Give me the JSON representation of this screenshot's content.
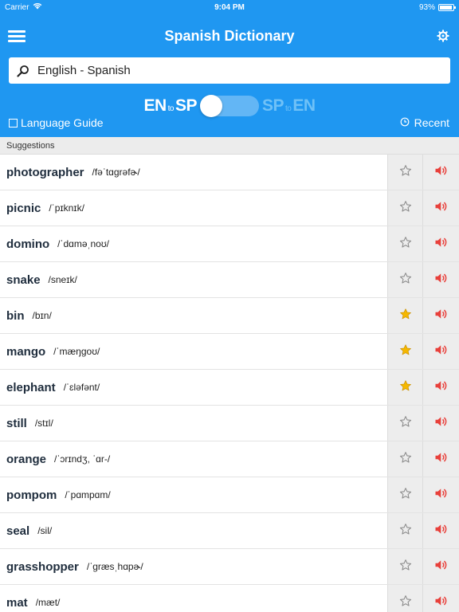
{
  "status": {
    "carrier": "Carrier",
    "time": "9:04 PM",
    "battery": "93%",
    "battery_level": 0.93
  },
  "nav": {
    "title": "Spanish Dictionary"
  },
  "search": {
    "value": "English - Spanish"
  },
  "direction": {
    "left": {
      "from": "EN",
      "to_word": "to",
      "target": "SP"
    },
    "right": {
      "from": "SP",
      "to_word": "to",
      "target": "EN"
    }
  },
  "guide_label": "Language Guide",
  "recent_label": "Recent",
  "section_title": "Suggestions",
  "words": [
    {
      "word": "photographer",
      "pron": "/fəˈtɑgrəfɚ/",
      "starred": false
    },
    {
      "word": "picnic",
      "pron": "/ˈpɪknɪk/",
      "starred": false
    },
    {
      "word": "domino",
      "pron": "/ˈdɑməˌnoʊ/",
      "starred": false
    },
    {
      "word": "snake",
      "pron": "/sneɪk/",
      "starred": false
    },
    {
      "word": "bin",
      "pron": "/bɪn/",
      "starred": true
    },
    {
      "word": "mango",
      "pron": "/ˈmæŋgoʊ/",
      "starred": true
    },
    {
      "word": "elephant",
      "pron": "/ˈɛləfənt/",
      "starred": true
    },
    {
      "word": "still",
      "pron": "/stɪl/",
      "starred": false
    },
    {
      "word": "orange",
      "pron": "/ˈɔrɪndʒ, ˈɑr-/",
      "starred": false
    },
    {
      "word": "pompom",
      "pron": "/ˈpɑmpɑm/",
      "starred": false
    },
    {
      "word": "seal",
      "pron": "/sil/",
      "starred": false
    },
    {
      "word": "grasshopper",
      "pron": "/ˈgræsˌhɑpɚ/",
      "starred": false
    },
    {
      "word": "mat",
      "pron": "/mæt/",
      "starred": false
    }
  ],
  "colors": {
    "header": "#1f97f1",
    "star_filled": "#f5b800",
    "speaker": "#e8403b"
  }
}
